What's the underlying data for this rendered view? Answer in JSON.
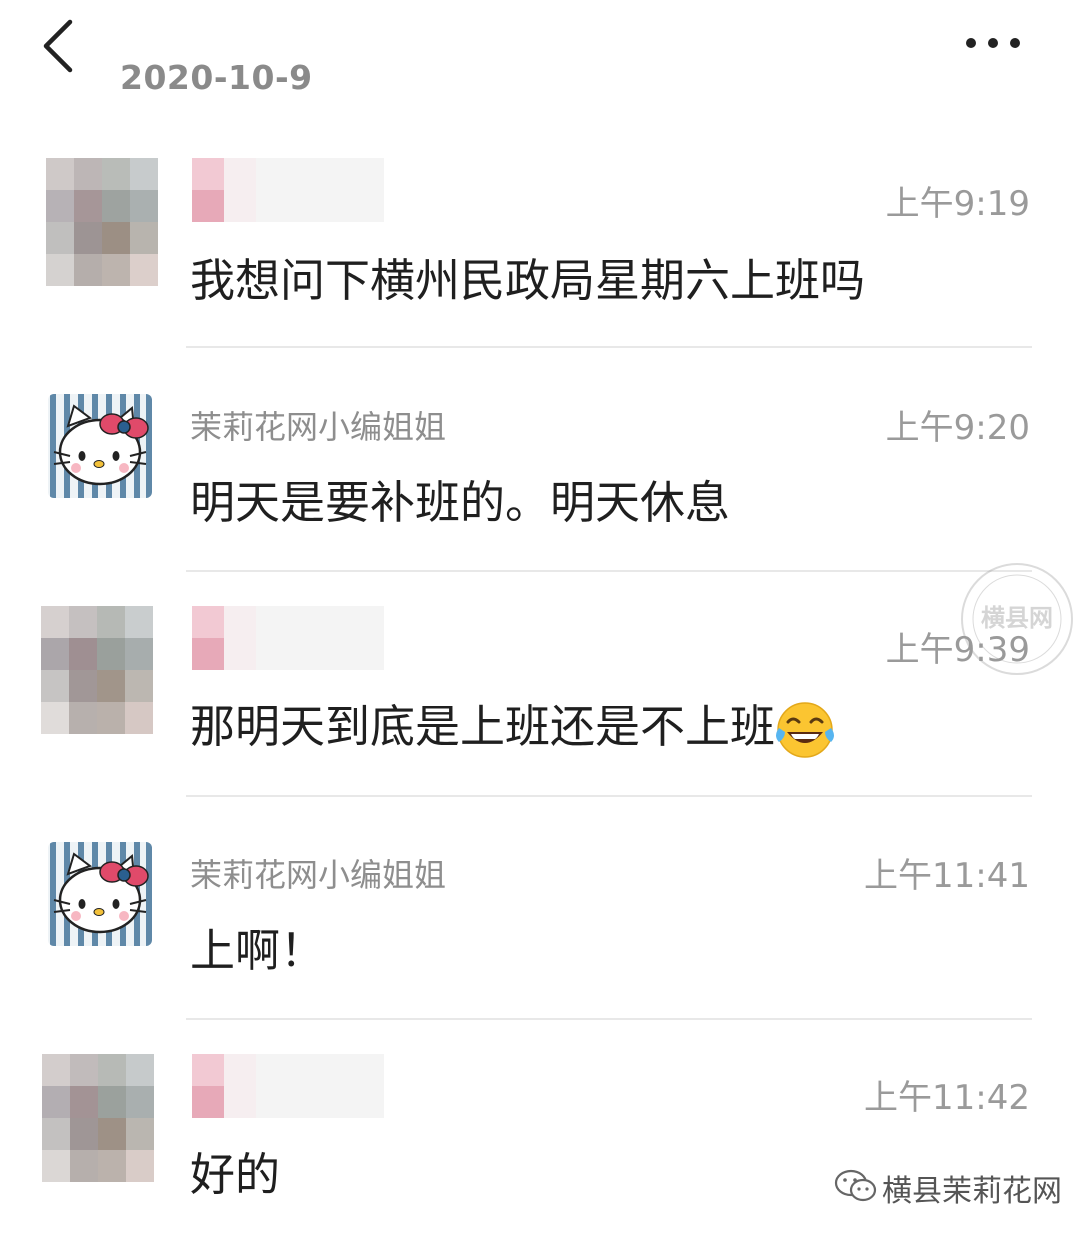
{
  "header": {
    "date": "2020-10-9",
    "back_icon": "chevron-left-icon",
    "more_icon": "more-dots-icon"
  },
  "messages": [
    {
      "sender": "",
      "time": "上午9:19",
      "text": "我想问下横州民政局星期六上班吗"
    },
    {
      "sender": "茉莉花网小编姐姐",
      "time": "上午9:20",
      "text": "明天是要补班的。明天休息"
    },
    {
      "sender": "",
      "time": "上午9:39",
      "text": "那明天到底是上班还是不上班",
      "emoji": "laughing-tears-emoji"
    },
    {
      "sender": "茉莉花网小编姐姐",
      "time": "上午11:41",
      "text": "上啊！"
    },
    {
      "sender": "",
      "time": "上午11:42",
      "text": "好的"
    }
  ],
  "watermark": {
    "text": "横县网"
  },
  "footer": {
    "account": "横县茉莉花网",
    "icon": "wechat-icon"
  },
  "colors": {
    "time": "#9a9a9a",
    "name": "#8e8e8e",
    "divider": "#e8e8e8"
  }
}
